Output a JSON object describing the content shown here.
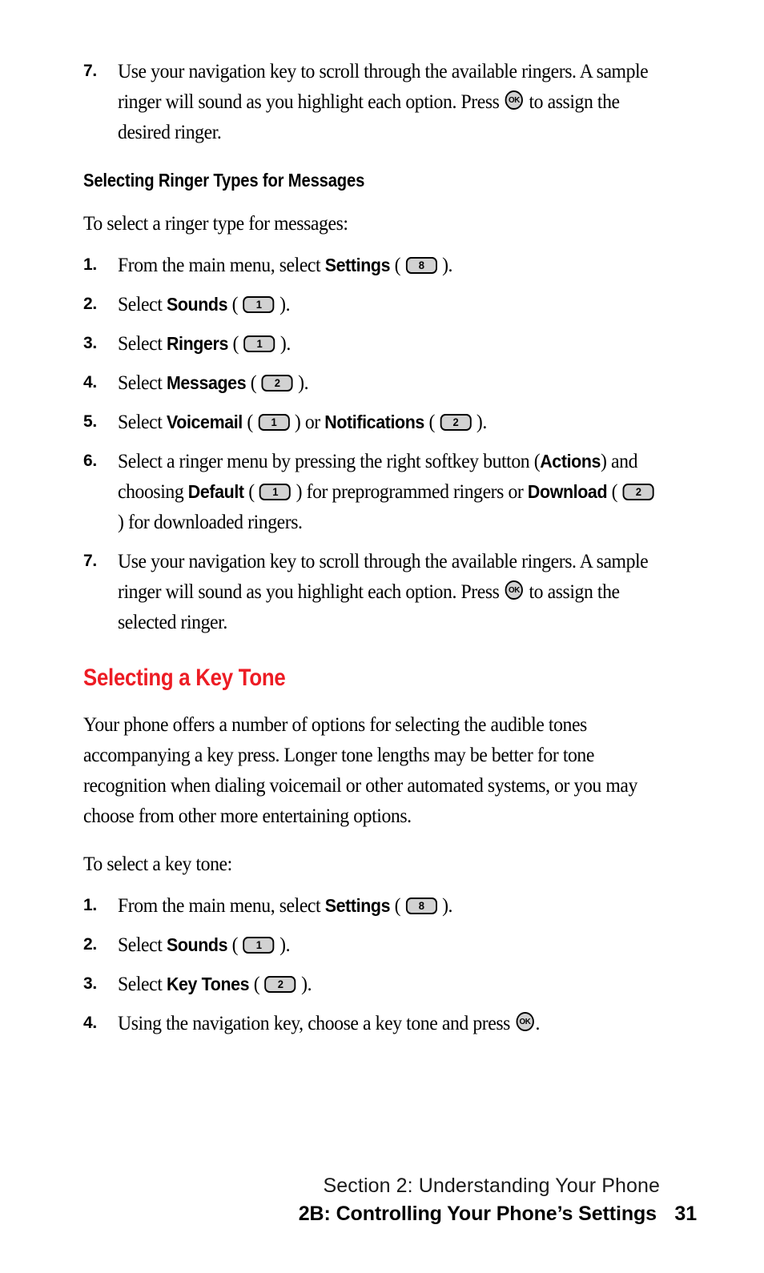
{
  "colors": {
    "section_heading": "#ED1C24",
    "text": "#000000",
    "keycap_fill": "#d2d2d2"
  },
  "sections": {
    "step7_top": {
      "number": "7.",
      "text_before_ok": "Use your navigation key to scroll through the available ringers. A sample ringer will sound as you highlight each option. Press ",
      "ok_label": "OK",
      "text_after_ok": " to assign the desired ringer."
    },
    "subheading_messages": "Selecting Ringer Types for Messages",
    "intro_messages": "To select a ringer type for messages:",
    "messages_steps": [
      {
        "number": "1.",
        "pre": "From the main menu, select ",
        "bold": "Settings",
        "mid": " ( ",
        "key": "8",
        "post": " )."
      },
      {
        "number": "2.",
        "pre": "Select ",
        "bold": "Sounds",
        "mid": " ( ",
        "key": "1",
        "post": " )."
      },
      {
        "number": "3.",
        "pre": "Select ",
        "bold": "Ringers",
        "mid": " ( ",
        "key": "1",
        "post": " )."
      },
      {
        "number": "4.",
        "pre": "Select ",
        "bold": "Messages",
        "mid": " ( ",
        "key": "2",
        "post": " )."
      }
    ],
    "step5": {
      "number": "5.",
      "pre": "Select ",
      "bold1": "Voicemail",
      "mid1": " ( ",
      "key1": "1",
      "mid2": " ) or ",
      "bold2": "Notifications",
      "mid3": " ( ",
      "key2": "2",
      "post": " )."
    },
    "step6": {
      "number": "6.",
      "pre": "Select a ringer menu by pressing the right softkey button (",
      "bold_actions": "Actions",
      "mid1": ") and choosing ",
      "bold_default": "Default",
      "mid2": " ( ",
      "key1": "1",
      "mid3": " ) for preprogrammed ringers or ",
      "bold_download": "Download",
      "mid4": " ( ",
      "key2": "2",
      "post": " ) for downloaded ringers."
    },
    "step7_bottom": {
      "number": "7.",
      "text_before_ok": "Use your navigation key to scroll through the available ringers. A sample ringer will sound as you highlight each option. Press ",
      "ok_label": "OK",
      "text_after_ok": " to assign the selected ringer."
    },
    "section_heading_keytone": "Selecting a Key Tone",
    "keytone_paragraph": "Your phone offers a number of options for selecting the audible tones accompanying a key press. Longer tone lengths may be better for tone recognition when dialing voicemail or other automated systems, or you may choose from other more entertaining options.",
    "intro_keytone": "To select a key tone:",
    "keytone_steps": [
      {
        "number": "1.",
        "pre": "From the main menu, select ",
        "bold": "Settings",
        "mid": " ( ",
        "key": "8",
        "post": " )."
      },
      {
        "number": "2.",
        "pre": "Select ",
        "bold": "Sounds",
        "mid": " ( ",
        "key": "1",
        "post": " )."
      },
      {
        "number": "3.",
        "pre": "Select ",
        "bold": "Key Tones",
        "mid": " ( ",
        "key": "2",
        "post": " )."
      }
    ],
    "keytone_step4": {
      "number": "4.",
      "text_before_ok": "Using the navigation key, choose a key tone and press ",
      "ok_label": "OK",
      "text_after_ok": "."
    }
  },
  "footer": {
    "section_line": "Section 2: Understanding Your Phone",
    "chapter_line": "2B: Controlling Your Phone’s Settings",
    "page_number": "31"
  }
}
